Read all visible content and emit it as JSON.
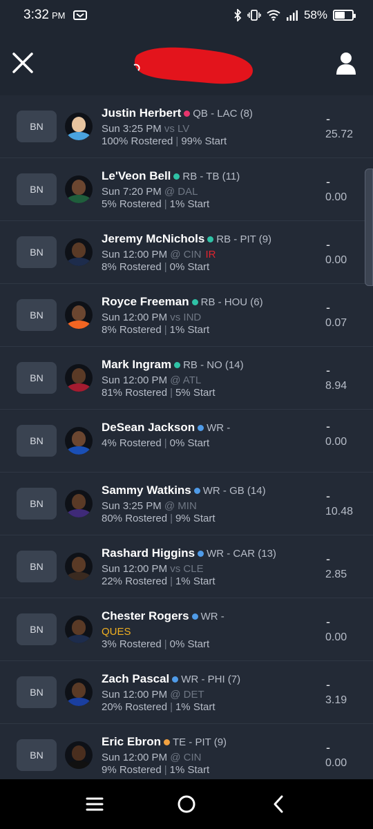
{
  "status": {
    "time": "3:32",
    "ampm": "PM",
    "battery_text": "58%",
    "battery_level": 0.58
  },
  "players": [
    {
      "slot": "BN",
      "name": "Justin Herbert",
      "dot_color": "#e8356d",
      "pos": "QB - LAC (8)",
      "game_time": "Sun 3:25 PM",
      "opp": "vs LV",
      "status": "",
      "rostered": "100% Rostered",
      "start": "99% Start",
      "proj_dash": "-",
      "proj": "25.72",
      "face": "#e7c4a0",
      "jersey": "#4aa3df"
    },
    {
      "slot": "BN",
      "name": "Le'Veon Bell",
      "dot_color": "#2fc2a6",
      "pos": "RB - TB (11)",
      "game_time": "Sun 7:20 PM",
      "opp": "@ DAL",
      "status": "",
      "rostered": "5% Rostered",
      "start": "1% Start",
      "proj_dash": "-",
      "proj": "0.00",
      "face": "#6b4630",
      "jersey": "#1f5e3c"
    },
    {
      "slot": "BN",
      "name": "Jeremy McNichols",
      "dot_color": "#2fc2a6",
      "pos": "RB - PIT (9)",
      "game_time": "Sun 12:00 PM",
      "opp": "@ CIN",
      "status": "IR",
      "rostered": "8% Rostered",
      "start": "0% Start",
      "proj_dash": "-",
      "proj": "0.00",
      "face": "#5a3a26",
      "jersey": "#1d2c4c"
    },
    {
      "slot": "BN",
      "name": "Royce Freeman",
      "dot_color": "#2fc2a6",
      "pos": "RB - HOU (6)",
      "game_time": "Sun 12:00 PM",
      "opp": "vs IND",
      "status": "",
      "rostered": "8% Rostered",
      "start": "1% Start",
      "proj_dash": "-",
      "proj": "0.07",
      "face": "#6b4630",
      "jersey": "#f26522"
    },
    {
      "slot": "BN",
      "name": "Mark Ingram",
      "dot_color": "#2fc2a6",
      "pos": "RB - NO (14)",
      "game_time": "Sun 12:00 PM",
      "opp": "@ ATL",
      "status": "",
      "rostered": "81% Rostered",
      "start": "5% Start",
      "proj_dash": "-",
      "proj": "8.94",
      "face": "#5a3a26",
      "jersey": "#a51c30"
    },
    {
      "slot": "BN",
      "name": "DeSean Jackson",
      "dot_color": "#4f9be8",
      "pos": "WR -",
      "game_time": "",
      "opp": "",
      "status": "",
      "rostered": "4% Rostered",
      "start": "0% Start",
      "proj_dash": "-",
      "proj": "0.00",
      "face": "#6b4630",
      "jersey": "#1a4fb5"
    },
    {
      "slot": "BN",
      "name": "Sammy Watkins",
      "dot_color": "#4f9be8",
      "pos": "WR - GB (14)",
      "game_time": "Sun 3:25 PM",
      "opp": "@ MIN",
      "status": "",
      "rostered": "80% Rostered",
      "start": "9% Start",
      "proj_dash": "-",
      "proj": "10.48",
      "face": "#5a3a26",
      "jersey": "#3f2a78"
    },
    {
      "slot": "BN",
      "name": "Rashard Higgins",
      "dot_color": "#4f9be8",
      "pos": "WR - CAR (13)",
      "game_time": "Sun 12:00 PM",
      "opp": "vs CLE",
      "status": "",
      "rostered": "22% Rostered",
      "start": "1% Start",
      "proj_dash": "-",
      "proj": "2.85",
      "face": "#5a3a26",
      "jersey": "#3a2a20"
    },
    {
      "slot": "BN",
      "name": "Chester Rogers",
      "dot_color": "#4f9be8",
      "pos": "WR -",
      "game_time": "",
      "opp": "",
      "status": "QUES",
      "rostered": "3% Rostered",
      "start": "0% Start",
      "proj_dash": "-",
      "proj": "0.00",
      "face": "#5a3a26",
      "jersey": "#1d2c4c"
    },
    {
      "slot": "BN",
      "name": "Zach Pascal",
      "dot_color": "#4f9be8",
      "pos": "WR - PHI (7)",
      "game_time": "Sun 12:00 PM",
      "opp": "@ DET",
      "status": "",
      "rostered": "20% Rostered",
      "start": "1% Start",
      "proj_dash": "-",
      "proj": "3.19",
      "face": "#5a3a26",
      "jersey": "#1a3fa0"
    },
    {
      "slot": "BN",
      "name": "Eric Ebron",
      "dot_color": "#f2a241",
      "pos": "TE - PIT (9)",
      "game_time": "Sun 12:00 PM",
      "opp": "@ CIN",
      "status": "",
      "rostered": "9% Rostered",
      "start": "1% Start",
      "proj_dash": "-",
      "proj": "0.00",
      "face": "#4a2e1e",
      "jersey": "#111111"
    }
  ]
}
